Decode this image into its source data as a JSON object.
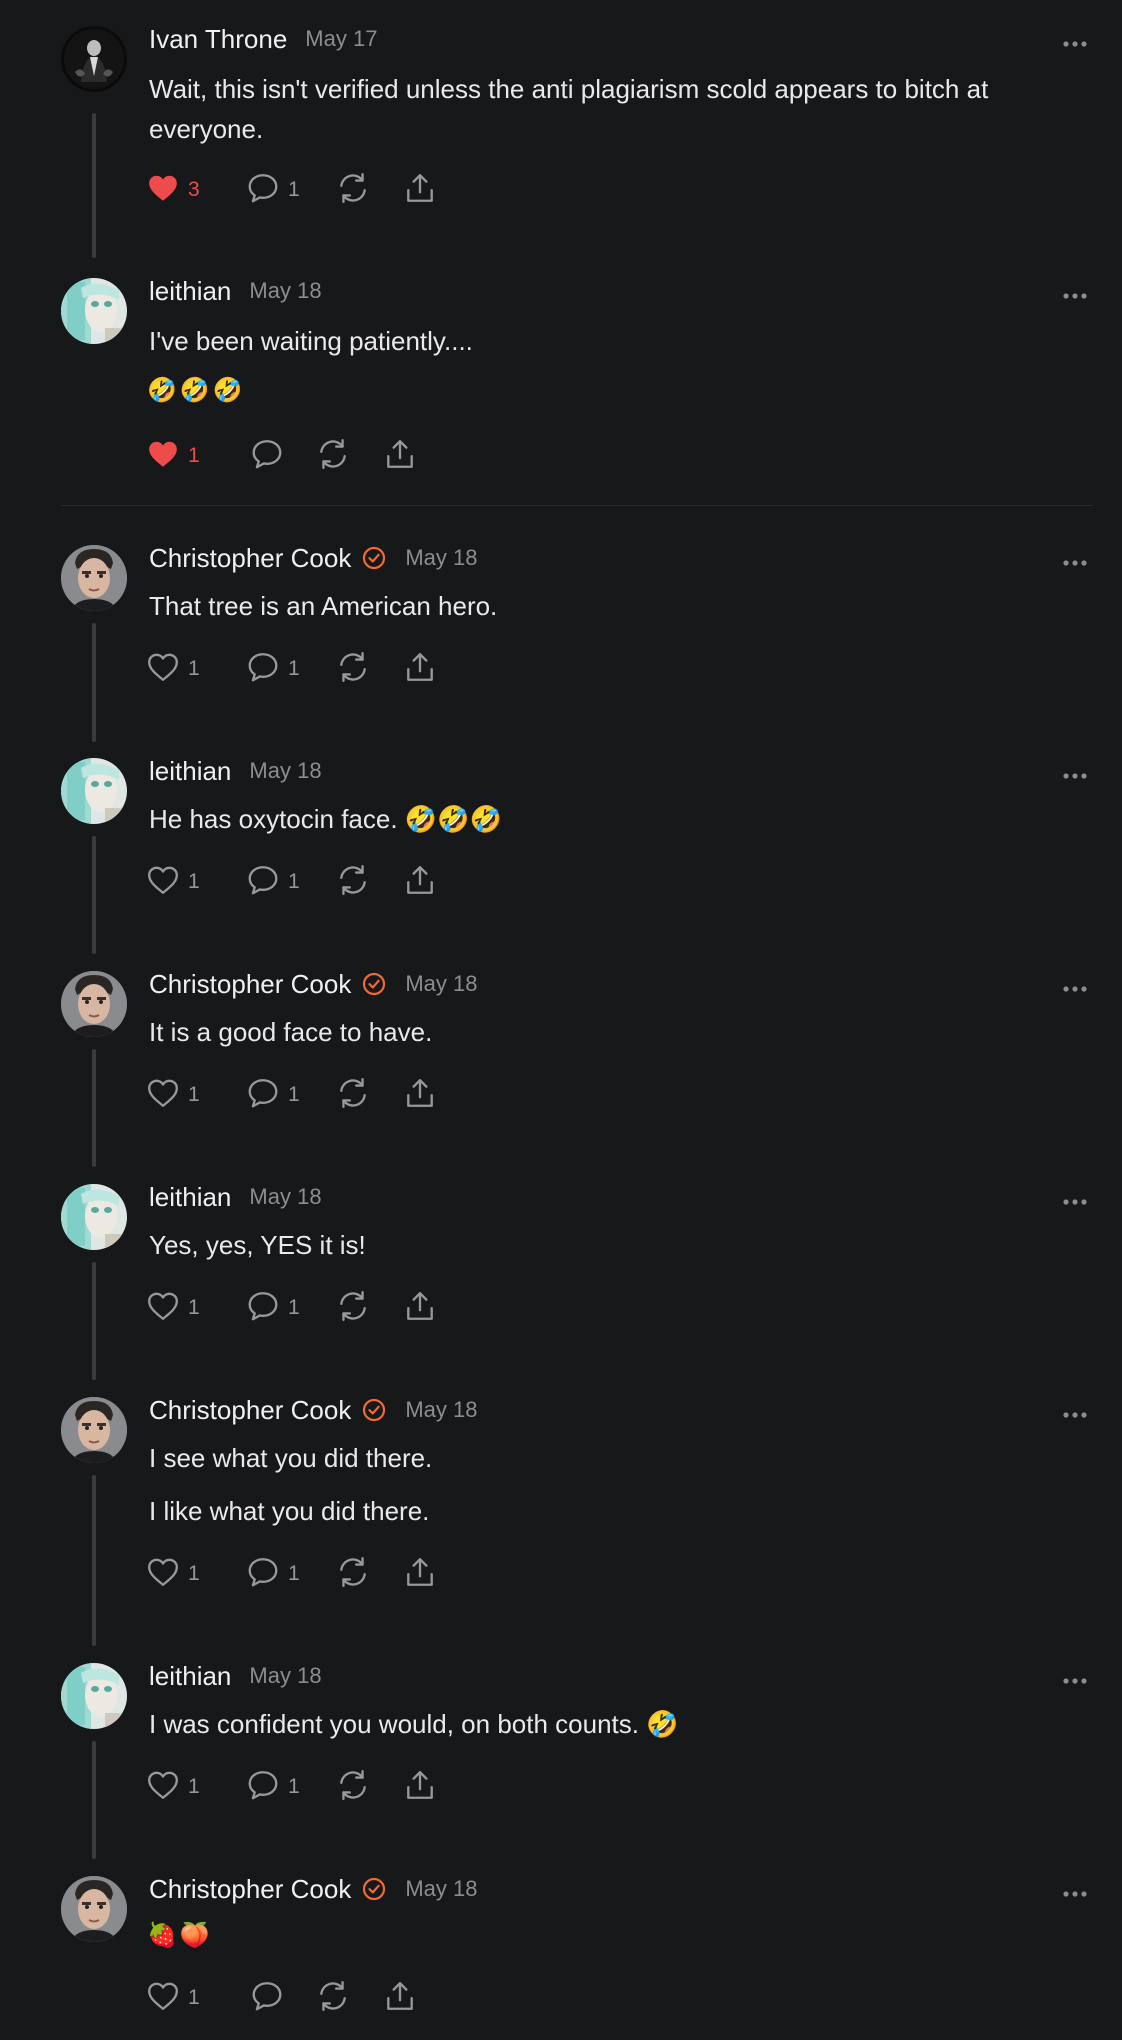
{
  "comments": [
    {
      "author": "Ivan Throne",
      "date": "May 17",
      "verified": false,
      "avatar": "ivan",
      "lines": [
        "Wait, this isn't verified unless the anti plagiarism scold appears to bitch at",
        "everyone."
      ],
      "emoji": [],
      "likes": "3",
      "liked": true,
      "replies": "1"
    },
    {
      "author": "leithian",
      "date": "May 18",
      "verified": false,
      "avatar": "leithian",
      "lines": [
        "I've been waiting patiently...."
      ],
      "emoji": [
        "🤣",
        "🤣",
        "🤣"
      ],
      "likes": "1",
      "liked": true,
      "replies": ""
    },
    {
      "author": "Christopher Cook",
      "date": "May 18",
      "verified": true,
      "avatar": "chris",
      "lines": [
        "That tree is an American hero."
      ],
      "emoji": [],
      "likes": "1",
      "liked": false,
      "replies": "1"
    },
    {
      "author": "leithian",
      "date": "May 18",
      "verified": false,
      "avatar": "leithian",
      "lines": [
        "He has oxytocin face. 🤣🤣🤣"
      ],
      "emoji": [],
      "likes": "1",
      "liked": false,
      "replies": "1"
    },
    {
      "author": "Christopher Cook",
      "date": "May 18",
      "verified": true,
      "avatar": "chris",
      "lines": [
        "It is a good face to have."
      ],
      "emoji": [],
      "likes": "1",
      "liked": false,
      "replies": "1"
    },
    {
      "author": "leithian",
      "date": "May 18",
      "verified": false,
      "avatar": "leithian",
      "lines": [
        "Yes, yes, YES it is!"
      ],
      "emoji": [],
      "likes": "1",
      "liked": false,
      "replies": "1"
    },
    {
      "author": "Christopher Cook",
      "date": "May 18",
      "verified": true,
      "avatar": "chris",
      "lines": [
        "I see what you did there.",
        "I like what you did there."
      ],
      "emoji": [],
      "likes": "1",
      "liked": false,
      "replies": "1"
    },
    {
      "author": "leithian",
      "date": "May 18",
      "verified": false,
      "avatar": "leithian",
      "lines": [
        "I was confident you would, on both counts. 🤣"
      ],
      "emoji": [],
      "likes": "1",
      "liked": false,
      "replies": "1"
    },
    {
      "author": "Christopher Cook",
      "date": "May 18",
      "verified": true,
      "avatar": "chris",
      "lines": [],
      "emoji": [
        "🍓",
        "🍑"
      ],
      "likes": "1",
      "liked": false,
      "replies": ""
    }
  ],
  "icons": {
    "like": "heart-icon",
    "reply": "comment-bubble-icon",
    "restack": "restack-arrows-icon",
    "share": "share-upload-icon",
    "more": "more-dots-icon",
    "verified": "verified-check-icon"
  },
  "colors": {
    "background": "#17181a",
    "accent_orange": "#f26a2e",
    "liked_red": "#ef4b4b",
    "muted": "#8c8d91"
  }
}
